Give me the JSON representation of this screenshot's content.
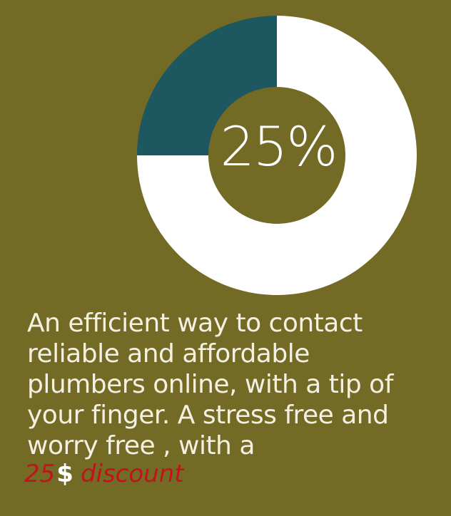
{
  "colors": {
    "background": "#736a26",
    "ring": "#ffffff",
    "highlight_segment": "#1d5760",
    "accent_red": "#c4121b"
  },
  "chart_data": {
    "type": "pie",
    "slices": [
      {
        "value": 25,
        "color": "#1d5760"
      },
      {
        "value": 75,
        "color": "#ffffff"
      }
    ],
    "center_label": "25%"
  },
  "description": "An efficient way to contact reliable and affordable plumbers online, with a tip of your finger. A stress free and worry free , with a",
  "discount": {
    "number": "25",
    "symbol": "$",
    "word": "discount"
  }
}
